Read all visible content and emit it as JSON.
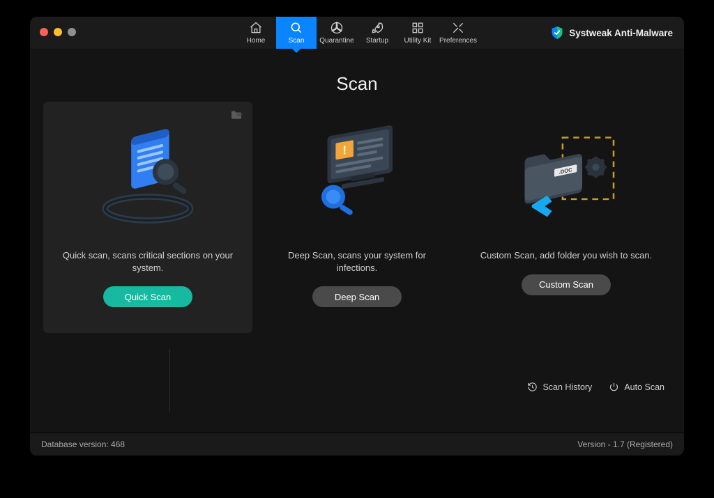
{
  "brand": "Systweak Anti-Malware",
  "nav": [
    {
      "id": "home",
      "label": "Home"
    },
    {
      "id": "scan",
      "label": "Scan",
      "active": true
    },
    {
      "id": "quarantine",
      "label": "Quarantine"
    },
    {
      "id": "startup",
      "label": "Startup"
    },
    {
      "id": "utility-kit",
      "label": "Utility Kit"
    },
    {
      "id": "preferences",
      "label": "Preferences"
    }
  ],
  "page": {
    "title": "Scan"
  },
  "cards": [
    {
      "id": "quick",
      "selected": true,
      "desc": "Quick scan, scans critical sections on your system.",
      "button": "Quick Scan",
      "button_color": "#17b9a0"
    },
    {
      "id": "deep",
      "selected": false,
      "desc": "Deep Scan, scans your system for infections.",
      "button": "Deep Scan",
      "button_color": "#4a4a4a"
    },
    {
      "id": "custom",
      "selected": false,
      "desc": "Custom Scan, add folder you wish to scan.",
      "button": "Custom Scan",
      "button_color": "#4a4a4a"
    }
  ],
  "secondary": {
    "history": "Scan History",
    "auto": "Auto Scan"
  },
  "footer": {
    "db": "Database version: 468",
    "version": "Version  -  1.7 (Registered)"
  },
  "colors": {
    "accent_blue": "#0a84ff",
    "accent_teal": "#17b9a0",
    "window_bg": "#141414",
    "card_sel_bg": "#222222"
  }
}
